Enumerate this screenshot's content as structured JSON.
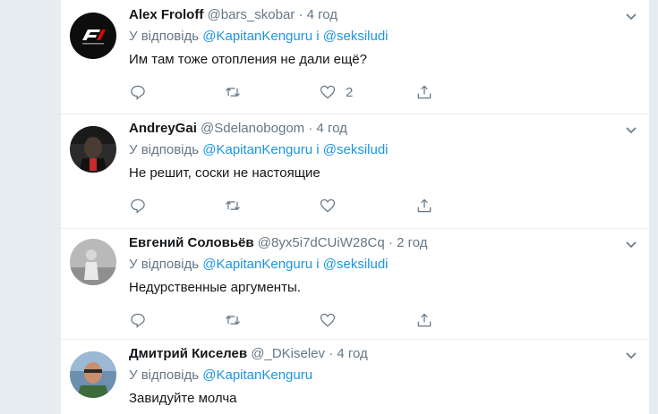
{
  "tweets": [
    {
      "name": "Alex Froloff",
      "handle": "@bars_skobar",
      "time": "4 год",
      "reply_prefix": "У відповідь",
      "mention1": "@KapitanKenguru",
      "conj": "і",
      "mention2": "@seksiludi",
      "text": "Им там тоже отопления не дали ещё?",
      "likes": "2",
      "avatar_icon": "f1-logo-avatar"
    },
    {
      "name": "AndreyGai",
      "handle": "@Sdelanobogom",
      "time": "4 год",
      "reply_prefix": "У відповідь",
      "mention1": "@KapitanKenguru",
      "conj": "і",
      "mention2": "@seksiludi",
      "text": "Не решит, соски не настоящие",
      "likes": "",
      "avatar_icon": "dark-photo-avatar"
    },
    {
      "name": "Евгений Соловьёв",
      "handle": "@8yx5i7dCUiW28Cq",
      "time": "2 год",
      "reply_prefix": "У відповідь",
      "mention1": "@KapitanKenguru",
      "conj": "і",
      "mention2": "@seksiludi",
      "text": "Недурственные аргументы.",
      "likes": "",
      "avatar_icon": "grey-photo-avatar"
    },
    {
      "name": "Дмитрий Киселев",
      "handle": "@_DKiselev",
      "time": "4 год",
      "reply_prefix": "У відповідь",
      "mention1": "@KapitanKenguru",
      "text": "Завидуйте молча",
      "avatar_icon": "man-photo-avatar"
    }
  ],
  "sep": "·",
  "colors": {
    "background": "#e6ecf0",
    "text": "#14171a",
    "secondary": "#657786",
    "link": "#1b95e0"
  }
}
